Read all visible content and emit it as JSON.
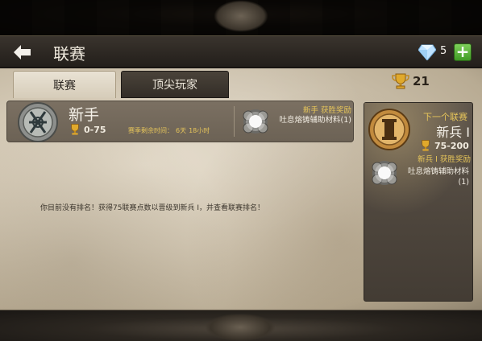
{
  "header": {
    "title": "联赛",
    "gem_count": "5"
  },
  "tabs": [
    {
      "label": "联赛",
      "active": true
    },
    {
      "label": "顶尖玩家",
      "active": false
    }
  ],
  "trophy_total": "21",
  "current_league": {
    "name": "新手",
    "range": "0-75",
    "season_label": "赛季剩余时间：",
    "days": "6天",
    "hours": "18小时",
    "reward_title": "新手 获胜奖励",
    "reward_item": "吐息熔铸辅助材料(1)"
  },
  "no_rank_message": "你目前没有排名！获得75联赛点数以晋级到新兵 I，并查看联赛排名！",
  "next_league": {
    "label": "下一个联赛",
    "name": "新兵 I",
    "range": "75-200",
    "reward_title": "新兵 I 获胜奖励",
    "reward_item": "吐息熔铸辅助材料(1)"
  },
  "colors": {
    "accent_gold": "#e6c55a",
    "plus_green": "#5cb83a"
  }
}
